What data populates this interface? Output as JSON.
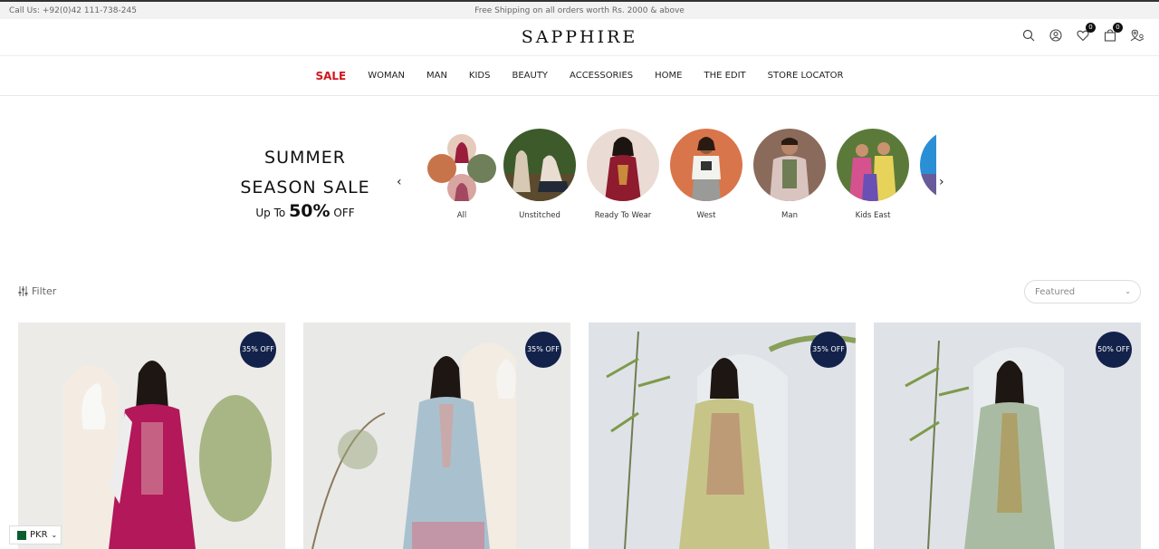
{
  "topbar": {
    "call": "Call Us: +92(0)42 111-738-245",
    "shipping": "Free Shipping on all orders worth Rs. 2000 & above"
  },
  "header": {
    "logo": "SAPPHIRE",
    "wishlist_count": "0",
    "cart_count": "0"
  },
  "nav": {
    "items": [
      "SALE",
      "WOMAN",
      "MAN",
      "KIDS",
      "BEAUTY",
      "ACCESSORIES",
      "HOME",
      "THE EDIT",
      "STORE LOCATOR"
    ],
    "sale_color": "#d0161d"
  },
  "banner": {
    "line1": "SUMMER",
    "line2": "SEASON SALE",
    "upto": "Up To",
    "percent": "50%",
    "off": "OFF"
  },
  "categories": [
    "All",
    "Unstitched",
    "Ready To Wear",
    "West",
    "Man",
    "Kids East"
  ],
  "toolbar": {
    "filter_label": "Filter",
    "sort_label": "Featured"
  },
  "products": [
    {
      "badge": "35% OFF"
    },
    {
      "badge": "35% OFF"
    },
    {
      "badge": "35% OFF"
    },
    {
      "badge": "50% OFF"
    }
  ],
  "currency": {
    "code": "PKR"
  },
  "colors": {
    "badge_bg": "#13224a",
    "sale": "#d0161d"
  }
}
